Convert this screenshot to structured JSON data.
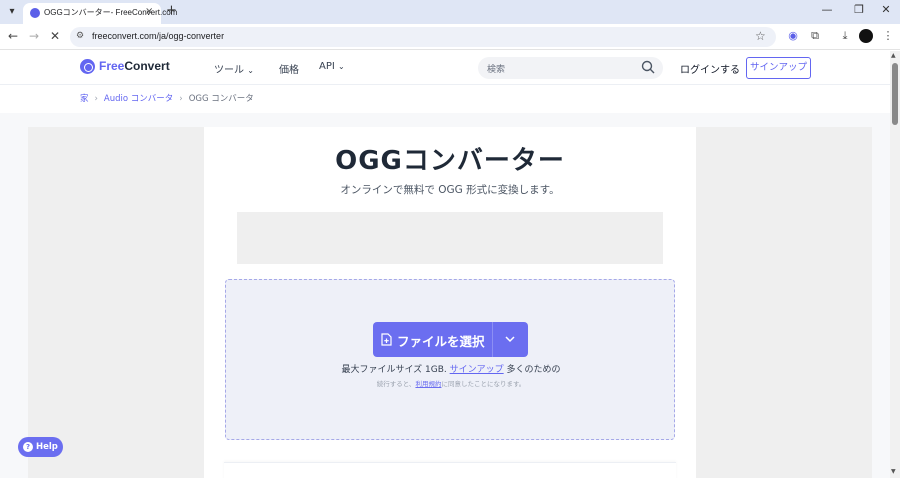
{
  "browser": {
    "tab_title": "OGGコンバーター- FreeConvert.com",
    "tab_close": "×",
    "new_tab": "+",
    "url": "freeconvert.com/ja/ogg-converter"
  },
  "header": {
    "logo_free": "Free",
    "logo_convert": "Convert",
    "nav": [
      {
        "label": "ツール",
        "has_dropdown": true
      },
      {
        "label": "価格",
        "has_dropdown": false
      },
      {
        "label": "API",
        "has_dropdown": true
      }
    ],
    "search_placeholder": "検索",
    "login": "ログインする",
    "signup": "サインアップ"
  },
  "breadcrumb": {
    "items": [
      "家",
      "Audio コンバータ",
      "OGG コンバータ"
    ]
  },
  "main": {
    "title": "OGGコンバーター",
    "subtitle": "オンラインで無料で OGG 形式に変換します。",
    "choose_files": "ファイルを選択",
    "max_size_prefix": "最大ファイルサイズ 1GB.",
    "max_size_link": "サインアップ",
    "max_size_suffix": "多くのための",
    "terms_prefix": "続行すると、",
    "terms_link": "利用規約",
    "terms_suffix": "に同意したことになります。"
  },
  "help": {
    "label": "Help"
  },
  "colors": {
    "accent": "#6366f1",
    "button": "#6b6ef0",
    "dropzone_bg": "#eef0f8",
    "ad_bg": "#efefef"
  }
}
